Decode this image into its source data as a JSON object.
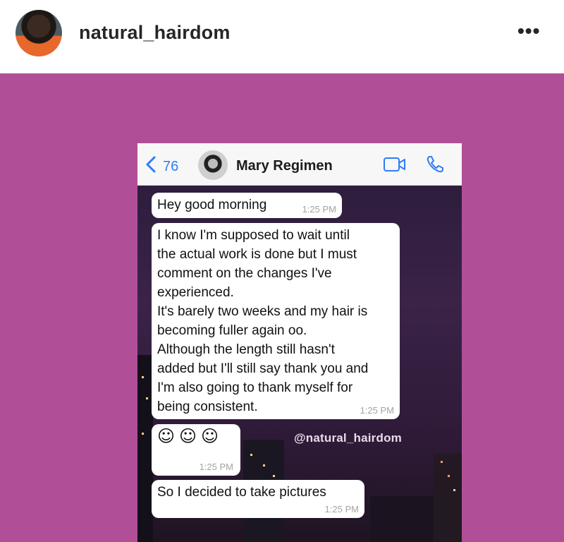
{
  "post": {
    "username": "natural_hairdom",
    "more_icon": "•••",
    "icons": {
      "avatar": "profile-avatar",
      "more": "ellipsis-icon"
    }
  },
  "chat": {
    "back_count": "76",
    "contact_name": "Mary Regimen",
    "icons": [
      "chevron-left-icon",
      "video-call-icon",
      "phone-icon"
    ],
    "accent_color": "#2f7cf6",
    "background_color": "#b04f97",
    "watermark": "@natural_hairdom",
    "messages": [
      {
        "text": "Hey good morning",
        "time": "1:25 PM"
      },
      {
        "text": "I know I'm supposed to wait until\nthe actual work is done but I must\ncomment on the changes I've\nexperienced.\nIt's barely two weeks and my hair is\nbecoming fuller again oo.\nAlthough the length still hasn't\nadded but I'll still say thank you and\nI'm also going to thank myself for\nbeing consistent.",
        "time": "1:25 PM"
      },
      {
        "text": "☺☺☺",
        "time": "1:25 PM"
      },
      {
        "text": "So I decided to take pictures",
        "time": "1:25 PM"
      }
    ]
  }
}
